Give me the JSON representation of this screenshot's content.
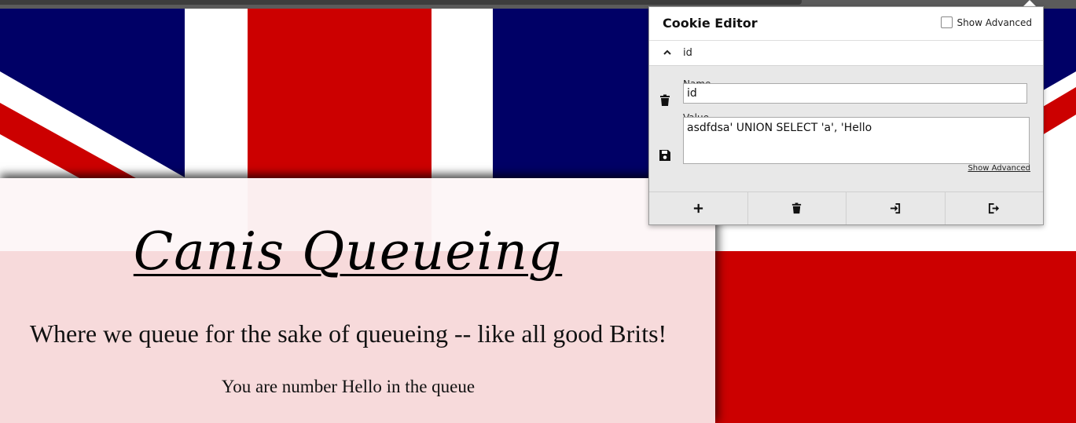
{
  "page": {
    "title": "Canis Queueing",
    "tagline": "Where we queue for the sake of queueing -- like all good Brits!",
    "queue_status": "You are number Hello in the queue"
  },
  "cookie_editor": {
    "title": "Cookie Editor",
    "show_advanced_label": "Show Advanced",
    "show_advanced_checked": false,
    "cookie": {
      "row_label": "id",
      "name_label": "Name",
      "name_value": "id",
      "value_label": "Value",
      "value_value": "asdfdsa' UNION SELECT 'a', 'Hello",
      "show_advanced_link": "Show Advanced"
    },
    "toolbar": {
      "add_icon": "plus-icon",
      "delete_all_icon": "trash-icon",
      "import_icon": "import-icon",
      "export_icon": "export-icon"
    }
  },
  "colors": {
    "flag_blue": "#000066",
    "flag_red": "#cc0000",
    "flag_white": "#ffffff"
  }
}
